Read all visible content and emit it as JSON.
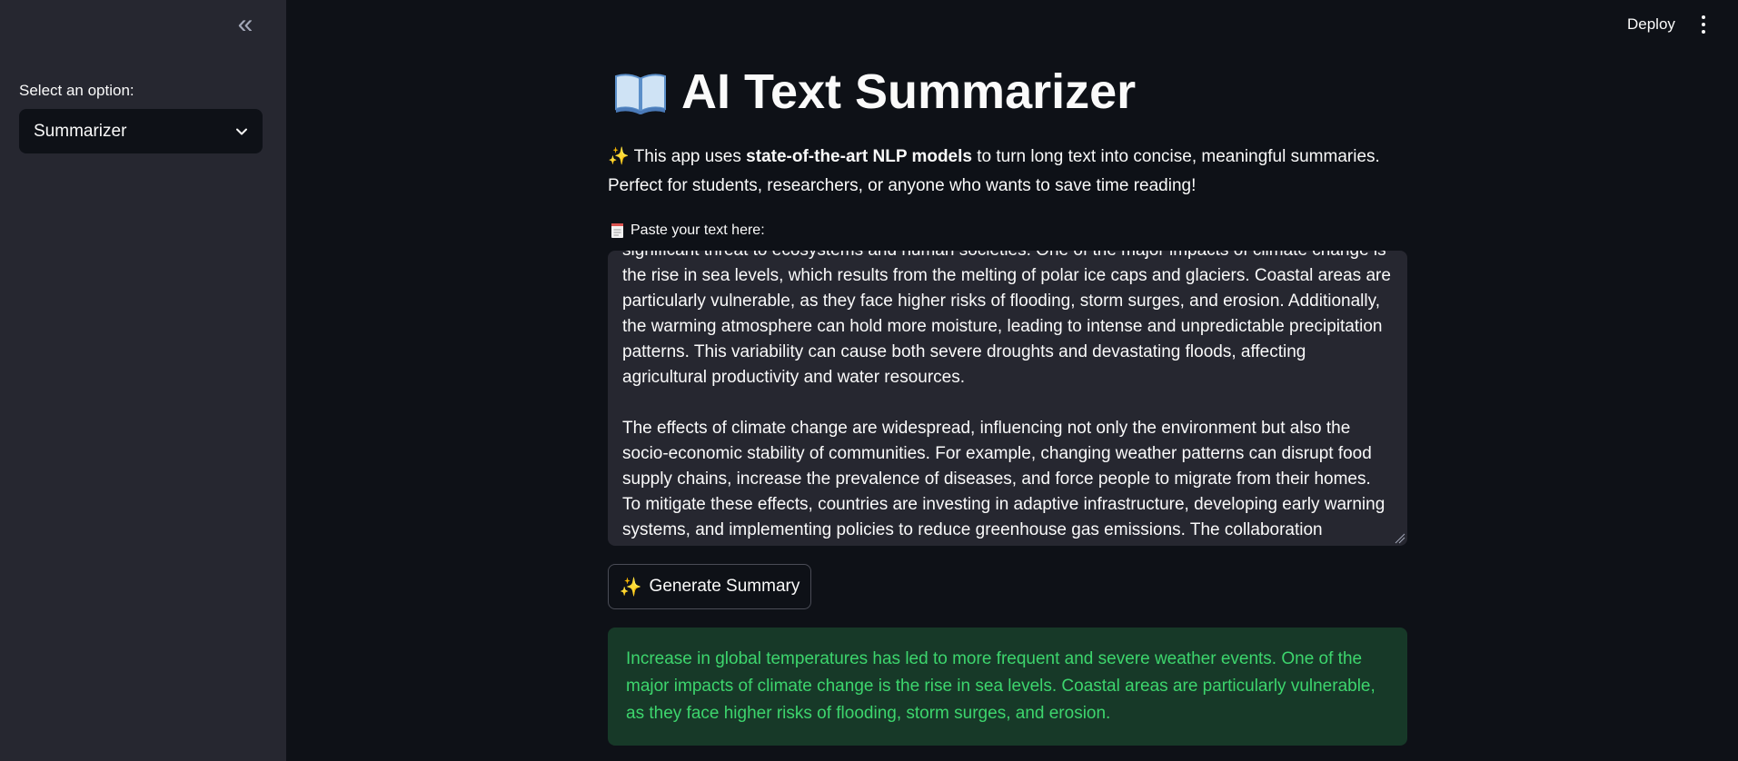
{
  "sidebar": {
    "collapse_icon": "double-chevron-left-icon",
    "select_label": "Select an option:",
    "select_value": "Summarizer"
  },
  "header": {
    "deploy_label": "Deploy",
    "menu_icon": "vertical-dots-icon"
  },
  "main": {
    "title": "AI Text Summarizer",
    "title_icon": "open-book-icon",
    "intro_prefix": "✨ This app uses ",
    "intro_bold": "state-of-the-art NLP models",
    "intro_suffix": " to turn long text into concise, meaningful summaries. Perfect for students, researchers, or anyone who wants to save time reading!",
    "textarea_label": "Paste your text here:",
    "textarea_icon": "memo-icon",
    "textarea_value": "significant threat to ecosystems and human societies. One of the major impacts of climate change is the rise in sea levels, which results from the melting of polar ice caps and glaciers. Coastal areas are particularly vulnerable, as they face higher risks of flooding, storm surges, and erosion. Additionally, the warming atmosphere can hold more moisture, leading to intense and unpredictable precipitation patterns. This variability can cause both severe droughts and devastating floods, affecting agricultural productivity and water resources.\n\nThe effects of climate change are widespread, influencing not only the environment but also the socio-economic stability of communities. For example, changing weather patterns can disrupt food supply chains, increase the prevalence of diseases, and force people to migrate from their homes. To mitigate these effects, countries are investing in adaptive infrastructure, developing early warning systems, and implementing policies to reduce greenhouse gas emissions. The collaboration",
    "generate_icon": "sparkles-icon",
    "generate_label": "Generate Summary",
    "summary_text": "Increase in global temperatures has led to more frequent and severe weather events. One of the major impacts of climate change is the rise in sea levels. Coastal areas are particularly vulnerable, as they face higher risks of flooding, storm surges, and erosion."
  },
  "colors": {
    "background": "#0e1117",
    "sidebar": "#262730",
    "success_bg": "#173928",
    "success_text": "#3dd56d"
  }
}
